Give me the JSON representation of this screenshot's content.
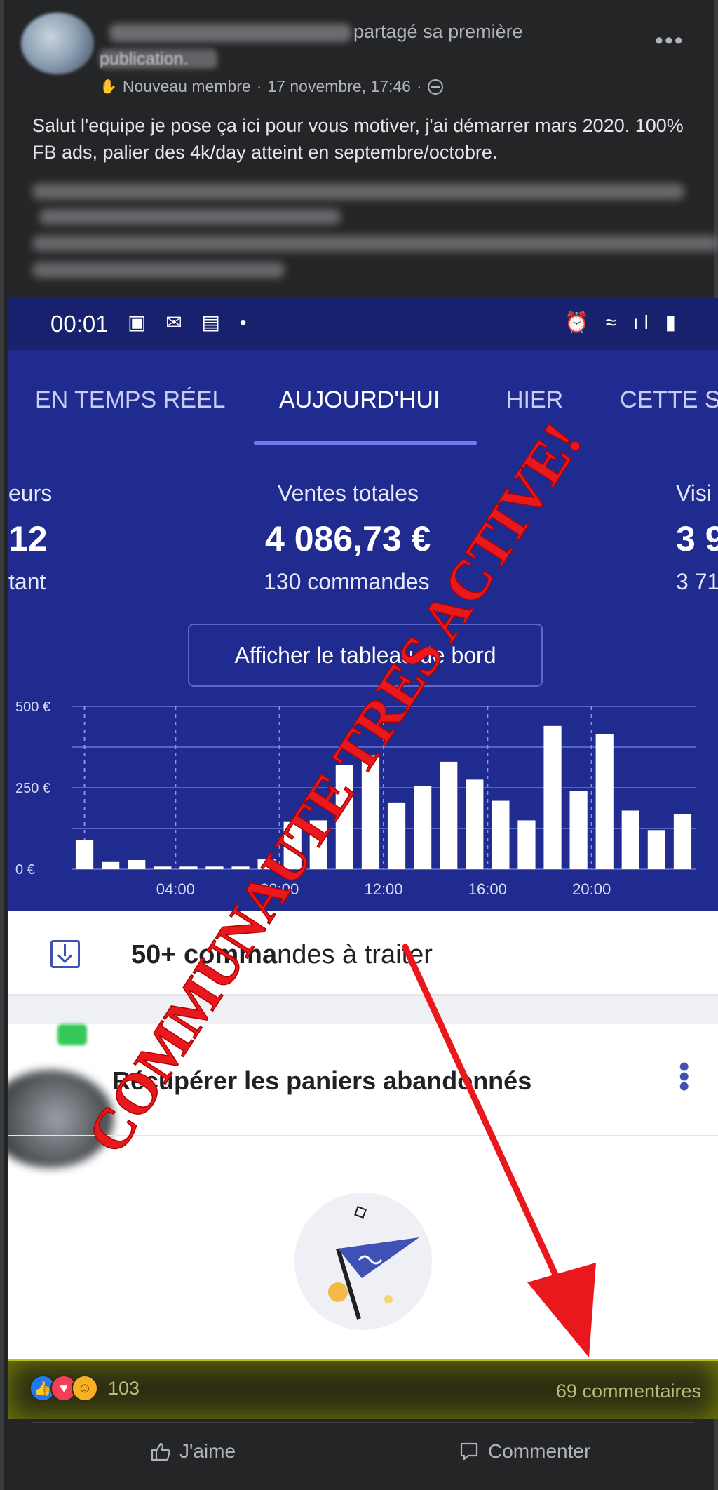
{
  "post": {
    "name_suffix": "partagé sa première",
    "name_line2": "publication.",
    "badge": "Nouveau membre",
    "timestamp": "17 novembre, 17:46",
    "more_icon": "ellipsis-icon",
    "text": "Salut l'equipe je pose ça ici pour vous motiver, j'ai démarrer mars 2020. 100% FB ads, palier des 4k/day atteint en septembre/octobre."
  },
  "screenshot": {
    "status": {
      "time": "00:01",
      "left_icons": "▣ ✉ ▤ •",
      "right_icons": "⏰ ≈ ıl ▮"
    },
    "tabs": [
      {
        "label": "EN TEMPS RÉEL"
      },
      {
        "label": "AUJOURD'HUI"
      },
      {
        "label": "HIER"
      },
      {
        "label": "CETTE S"
      }
    ],
    "metrics": {
      "left": {
        "label": "eurs",
        "value": "12",
        "sub": "tant"
      },
      "center": {
        "label": "Ventes totales",
        "value": "4 086,73 €",
        "sub": "130 commandes"
      },
      "right": {
        "label": "Visi",
        "value": "3 9",
        "sub": "3 71"
      }
    },
    "dashboard_button": "Afficher le tableau de bord",
    "todo": {
      "count": "50+ comma",
      "rest": "ndes à traiter"
    },
    "cart": {
      "title": "Récupérer les paniers abandonnés"
    }
  },
  "chart_data": {
    "type": "bar",
    "ylabel": "",
    "xlabel": "",
    "y_ticks": [
      "0 €",
      "250 €",
      "500 €"
    ],
    "ylim": [
      0,
      500
    ],
    "x_tick_labels": [
      "04:00",
      "08:00",
      "12:00",
      "16:00",
      "20:00"
    ],
    "categories": [
      "00:00",
      "01:00",
      "02:00",
      "03:00",
      "04:00",
      "05:00",
      "06:00",
      "07:00",
      "08:00",
      "09:00",
      "10:00",
      "11:00",
      "12:00",
      "13:00",
      "14:00",
      "15:00",
      "16:00",
      "17:00",
      "18:00",
      "19:00",
      "20:00",
      "21:00",
      "22:00",
      "23:00"
    ],
    "values": [
      90,
      22,
      28,
      8,
      8,
      8,
      8,
      30,
      145,
      150,
      320,
      350,
      205,
      255,
      330,
      275,
      210,
      150,
      440,
      240,
      415,
      180,
      120,
      170
    ],
    "grid": true,
    "colors": {
      "bar": "#ffffff",
      "grid": "#5664c9",
      "background": "#1f2b8f"
    }
  },
  "overlay": {
    "stamp_text": "COMMUNAUTE TRES ACTIVE!",
    "stamp_color": "#e8181c",
    "arrow_color": "#e8181c"
  },
  "footer": {
    "reaction_icons": [
      "like-icon",
      "love-icon",
      "haha-icon"
    ],
    "reaction_count": "103",
    "comments": "69 commentaires",
    "like_label": "J'aime",
    "comment_label": "Commenter"
  }
}
